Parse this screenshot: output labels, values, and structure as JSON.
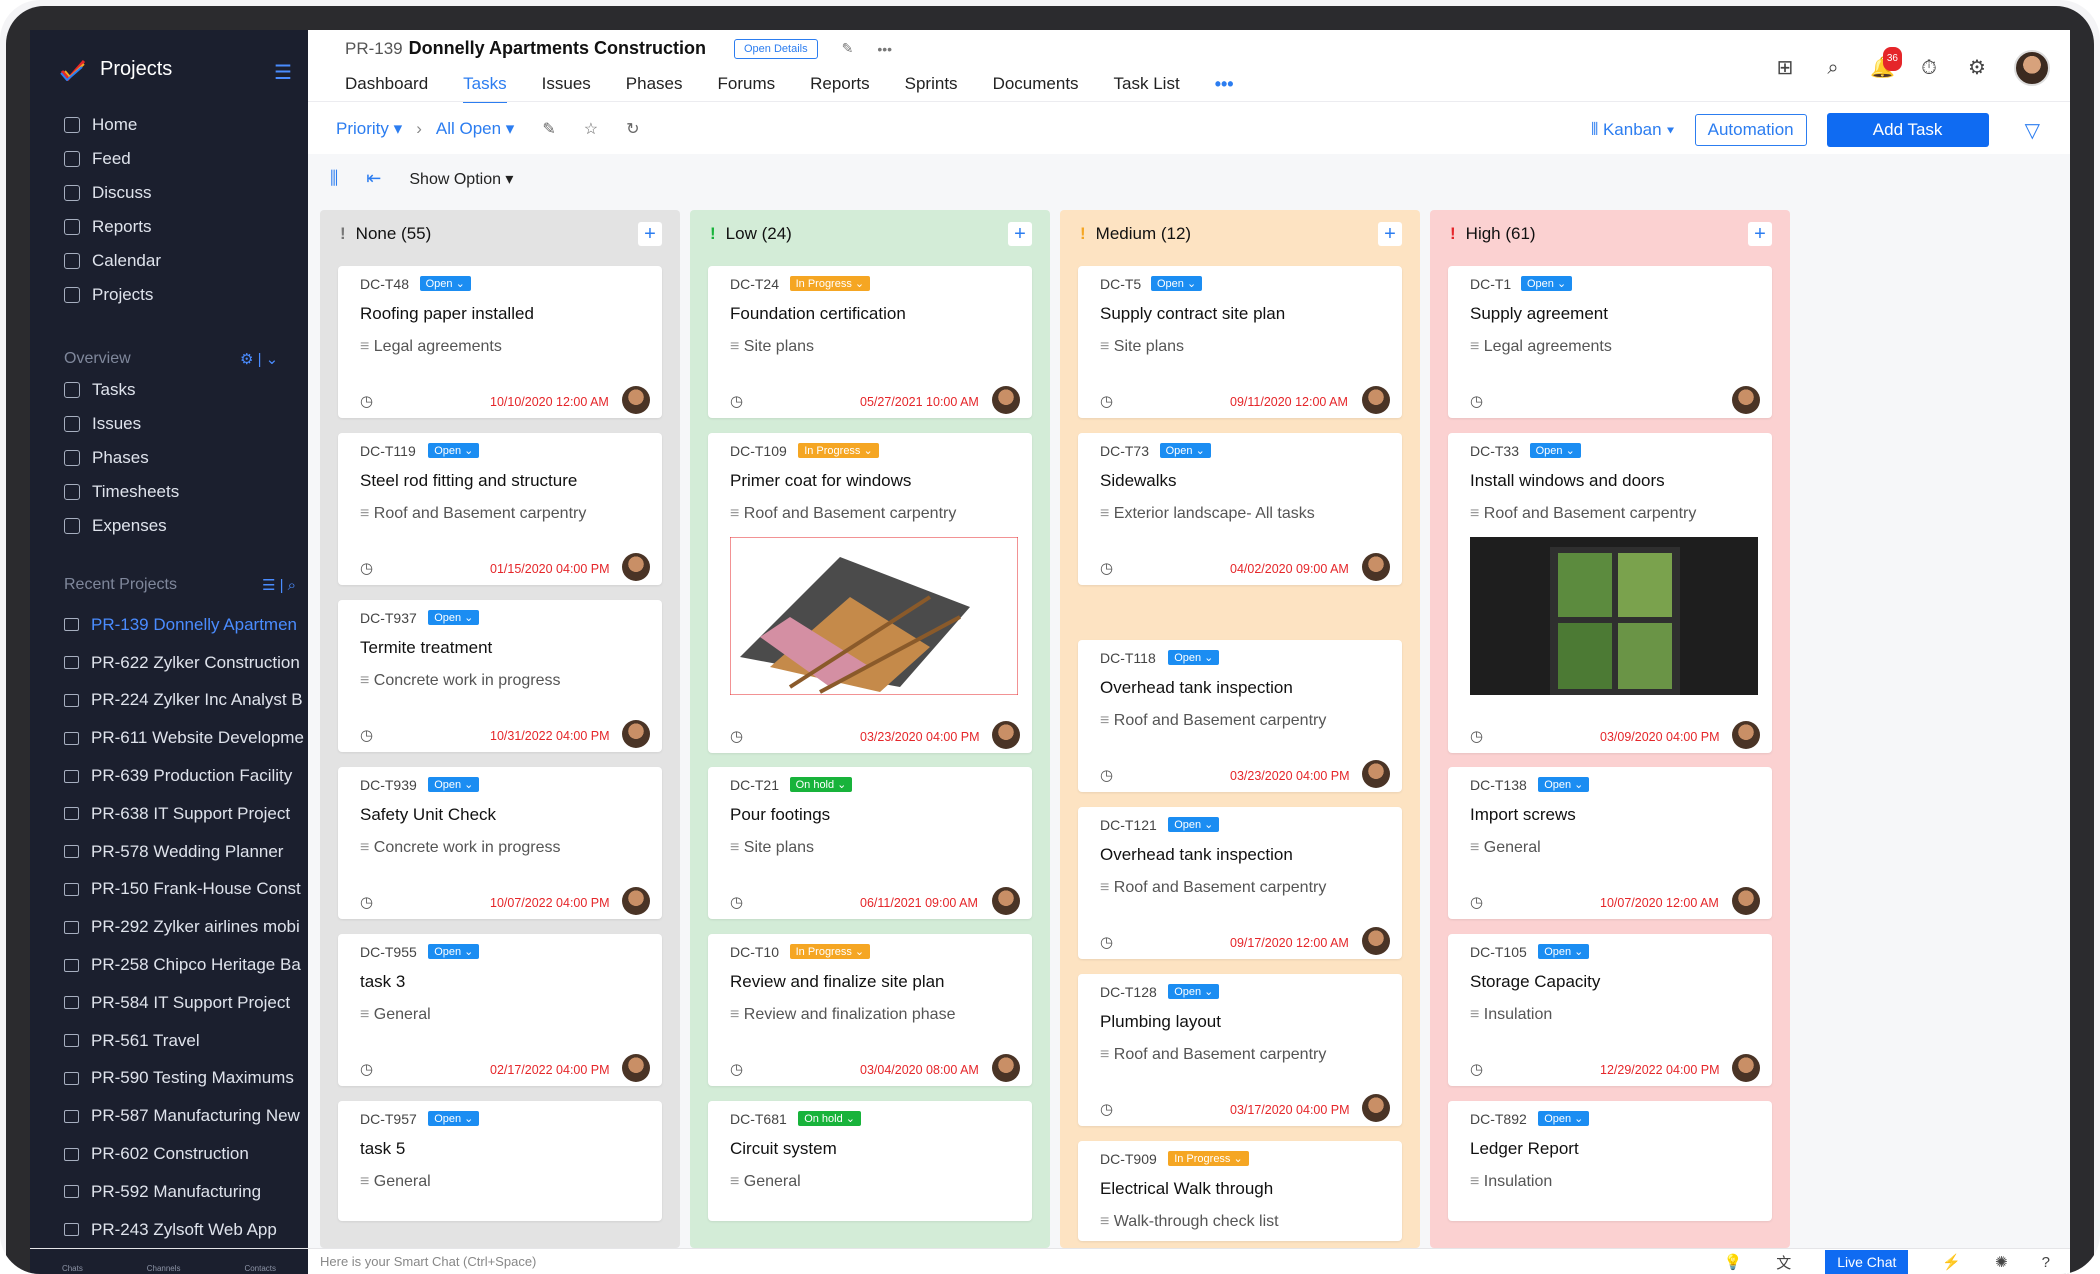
{
  "sidebar": {
    "brand": "Projects",
    "nav": [
      "Home",
      "Feed",
      "Discuss",
      "Reports",
      "Calendar",
      "Projects"
    ],
    "overview_title": "Overview",
    "overview_items": [
      "Tasks",
      "Issues",
      "Phases",
      "Timesheets",
      "Expenses"
    ],
    "recent_title": "Recent Projects",
    "recent": [
      "PR-139 Donnelly Apartmen",
      "PR-622 Zylker Construction",
      "PR-224 Zylker Inc Analyst B",
      "PR-611 Website Developme",
      "PR-639 Production Facility",
      "PR-638 IT Support Project",
      "PR-578 Wedding Planner",
      "PR-150 Frank-House Const",
      "PR-292 Zylker airlines mobi",
      "PR-258 Chipco Heritage Ba",
      "PR-584 IT Support Project",
      "PR-561 Travel",
      "PR-590 Testing Maximums",
      "PR-587 Manufacturing New",
      "PR-602 Construction",
      "PR-592 Manufacturing",
      "PR-243 Zylsoft Web App"
    ]
  },
  "header": {
    "project_code": "PR-139",
    "project_title": "Donnelly Apartments Construction",
    "open_details": "Open Details",
    "tabs": [
      "Dashboard",
      "Tasks",
      "Issues",
      "Phases",
      "Forums",
      "Reports",
      "Sprints",
      "Documents",
      "Task List"
    ],
    "active_tab": "Tasks",
    "more": "•••",
    "notification_count": "36"
  },
  "toolbar": {
    "priority": "Priority",
    "all_open": "All Open",
    "kanban": "Kanban",
    "automation": "Automation",
    "add_task": "Add Task",
    "show_option": "Show Option"
  },
  "columns": [
    {
      "name": "None (55)",
      "color": "#e3e3e3",
      "excl_color": "#777777",
      "cards": [
        {
          "id": "DC-T48",
          "status": "Open",
          "title": "Roofing paper installed",
          "list": "Legal agreements",
          "date": "10/10/2020 12:00 AM"
        },
        {
          "id": "DC-T119",
          "status": "Open",
          "title": "Steel rod fitting and structure",
          "list": "Roof and Basement carpentry",
          "date": "01/15/2020 04:00 PM"
        },
        {
          "id": "DC-T937",
          "status": "Open",
          "title": "Termite treatment",
          "list": "Concrete work in progress",
          "date": "10/31/2022 04:00 PM"
        },
        {
          "id": "DC-T939",
          "status": "Open",
          "title": "Safety Unit Check",
          "list": "Concrete work in progress",
          "date": "10/07/2022 04:00 PM"
        },
        {
          "id": "DC-T955",
          "status": "Open",
          "title": "task 3",
          "list": "General",
          "date": "02/17/2022 04:00 PM"
        },
        {
          "id": "DC-T957",
          "status": "Open",
          "title": "task 5",
          "list": "General",
          "date": ""
        }
      ]
    },
    {
      "name": "Low (24)",
      "color": "#d3ecd7",
      "excl_color": "#18b33b",
      "cards": [
        {
          "id": "DC-T24",
          "status": "In Progress",
          "title": "Foundation certification",
          "list": "Site plans",
          "date": "05/27/2021 10:00 AM"
        },
        {
          "id": "DC-T109",
          "status": "In Progress",
          "title": "Primer coat for windows",
          "list": "Roof and Basement carpentry",
          "date": "03/23/2020 04:00 PM"
        },
        {
          "id": "DC-T21",
          "status": "On hold",
          "title": "Pour footings",
          "list": "Site plans",
          "date": "06/11/2021 09:00 AM"
        },
        {
          "id": "DC-T10",
          "status": "In Progress",
          "title": "Review and finalize site plan",
          "list": "Review and finalization phase",
          "date": "03/04/2020 08:00 AM"
        },
        {
          "id": "DC-T681",
          "status": "On hold",
          "title": "Circuit system",
          "list": "General",
          "date": ""
        }
      ]
    },
    {
      "name": "Medium (12)",
      "color": "#fde3c2",
      "excl_color": "#f5a623",
      "cards": [
        {
          "id": "DC-T5",
          "status": "Open",
          "title": "Supply contract site plan",
          "list": "Site plans",
          "date": "09/11/2020 12:00 AM"
        },
        {
          "id": "DC-T73",
          "status": "Open",
          "title": "Sidewalks",
          "list": "Exterior landscape- All tasks",
          "date": "04/02/2020 09:00 AM"
        },
        {
          "id": "DC-T118",
          "status": "Open",
          "title": "Overhead tank inspection",
          "list": "Roof and Basement carpentry",
          "date": "03/23/2020 04:00 PM"
        },
        {
          "id": "DC-T121",
          "status": "Open",
          "title": "Overhead tank inspection",
          "list": "Roof and Basement carpentry",
          "date": "09/17/2020 12:00 AM"
        },
        {
          "id": "DC-T128",
          "status": "Open",
          "title": "Plumbing layout",
          "list": "Roof and Basement carpentry",
          "date": "03/17/2020 04:00 PM"
        },
        {
          "id": "DC-T909",
          "status": "In Progress",
          "title": "Electrical Walk through",
          "list": "Walk-through check list",
          "date": ""
        }
      ]
    },
    {
      "name": "High (61)",
      "color": "#fbd1d1",
      "excl_color": "#e5262a",
      "cards": [
        {
          "id": "DC-T1",
          "status": "Open",
          "title": "Supply agreement",
          "list": "Legal agreements",
          "date": ""
        },
        {
          "id": "DC-T33",
          "status": "Open",
          "title": "Install windows and doors",
          "list": "Roof and Basement carpentry",
          "date": "03/09/2020 04:00 PM"
        },
        {
          "id": "DC-T138",
          "status": "Open",
          "title": "Import screws",
          "list": "General",
          "date": "10/07/2020 12:00 AM"
        },
        {
          "id": "DC-T105",
          "status": "Open",
          "title": "Storage Capacity",
          "list": "Insulation",
          "date": "12/29/2022 04:00 PM"
        },
        {
          "id": "DC-T892",
          "status": "Open",
          "title": "Ledger Report",
          "list": "Insulation",
          "date": ""
        }
      ]
    }
  ],
  "footer": {
    "chats": "Chats",
    "channels": "Channels",
    "contacts": "Contacts",
    "smart_chat": "Here is your Smart Chat (Ctrl+Space)",
    "live_chat": "Live Chat"
  }
}
